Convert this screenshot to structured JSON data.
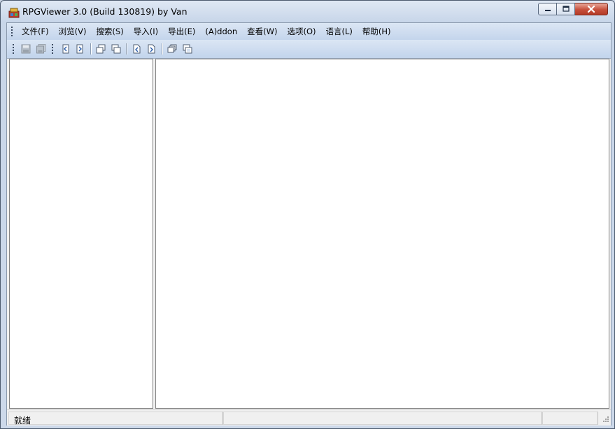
{
  "window": {
    "title": "RPGViewer 3.0 (Build 130819) by Van",
    "app_icon": "rpgviewer-app-icon"
  },
  "caption_buttons": {
    "minimize_icon": "minimize-icon",
    "maximize_icon": "maximize-icon",
    "close_icon": "close-icon"
  },
  "menubar": {
    "items": [
      {
        "label": "文件(F)"
      },
      {
        "label": "浏览(V)"
      },
      {
        "label": "搜索(S)"
      },
      {
        "label": "导入(I)"
      },
      {
        "label": "导出(E)"
      },
      {
        "label": "(A)ddon"
      },
      {
        "label": "查看(W)"
      },
      {
        "label": "选项(O)"
      },
      {
        "label": "语言(L)"
      },
      {
        "label": "帮助(H)"
      }
    ]
  },
  "toolbar": {
    "buttons": [
      {
        "icon": "save-icon",
        "enabled": false
      },
      {
        "icon": "save-all-icon",
        "enabled": false
      },
      {
        "icon": "previous-page-icon",
        "enabled": true
      },
      {
        "icon": "next-page-icon",
        "enabled": true
      },
      {
        "icon": "copy-window-icon",
        "enabled": true
      },
      {
        "icon": "paste-window-icon",
        "enabled": true
      },
      {
        "icon": "previous-file-icon",
        "enabled": true
      },
      {
        "icon": "next-file-icon",
        "enabled": true
      },
      {
        "icon": "cascade-windows-icon",
        "enabled": true
      },
      {
        "icon": "tile-windows-icon",
        "enabled": true
      }
    ]
  },
  "statusbar": {
    "text": "就绪"
  },
  "colors": {
    "titlebar": "#dfe8f4",
    "menubar": "#c4d5ec",
    "close_button": "#c7503c",
    "pane_background": "#ffffff"
  }
}
